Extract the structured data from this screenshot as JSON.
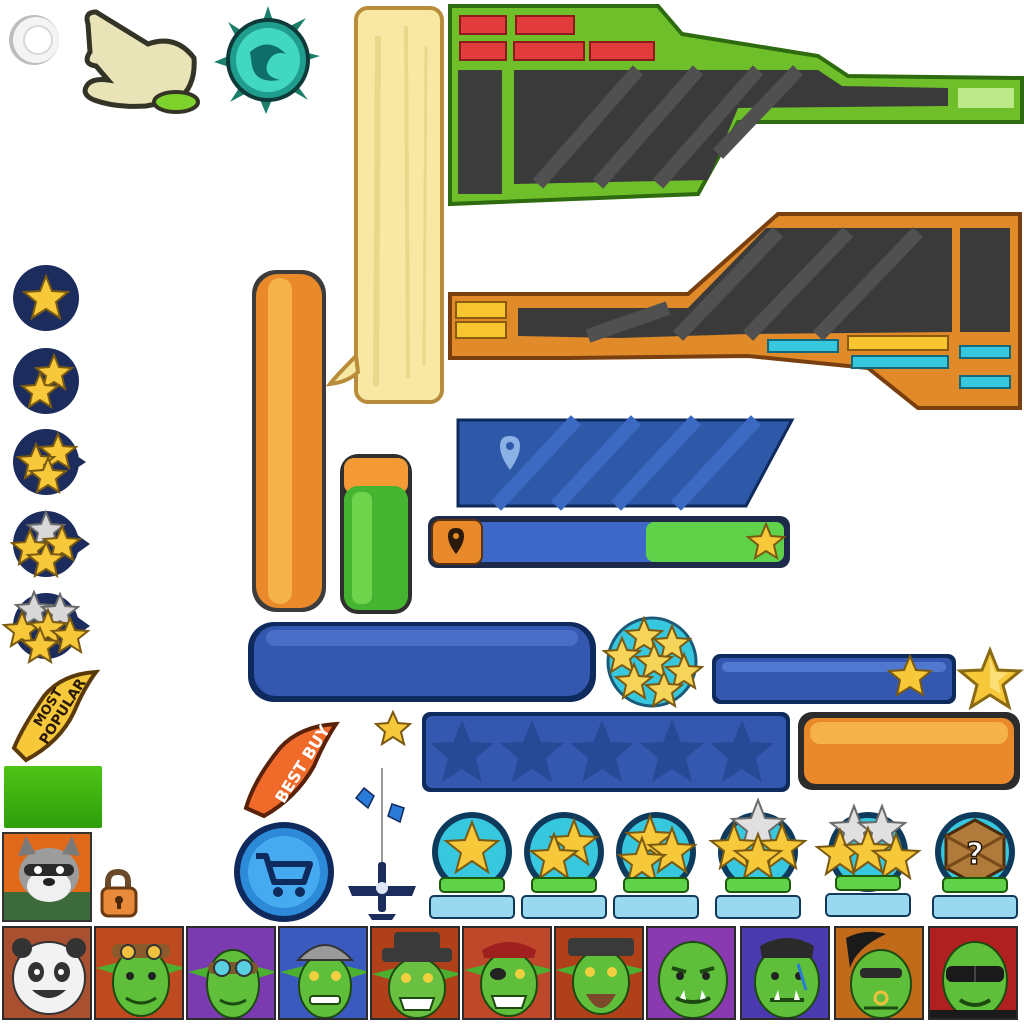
{
  "sheet": {
    "ribbons": {
      "most_popular": [
        "MOST",
        "POPULAR"
      ],
      "best_buy": "BEST BUY"
    },
    "unknown_reward_glyph": "?"
  },
  "colors": {
    "green_panel": "#6fbf2a",
    "orange_panel": "#e08a2a",
    "blue_panel": "#2e58a8",
    "dark_navy": "#1c2c5c",
    "star_gold": "#f6c83a",
    "cyan_glow": "#37c7df",
    "goblin_green": "#5fbf3a"
  },
  "icons": [
    "radio-dot-icon",
    "pointing-hand-icon",
    "energy-orb-icon",
    "star-icon",
    "map-pin-icon",
    "shopping-cart-icon",
    "lock-icon",
    "plane-icon",
    "crate-icon"
  ],
  "portraits": [
    "panda",
    "goblin-pilot",
    "goblin-goggles",
    "goblin-helmet",
    "goblin-hat",
    "goblin-eyepatch",
    "goblin-beard",
    "orc-bald",
    "orc-scar",
    "orc-ring",
    "orc-shades"
  ]
}
